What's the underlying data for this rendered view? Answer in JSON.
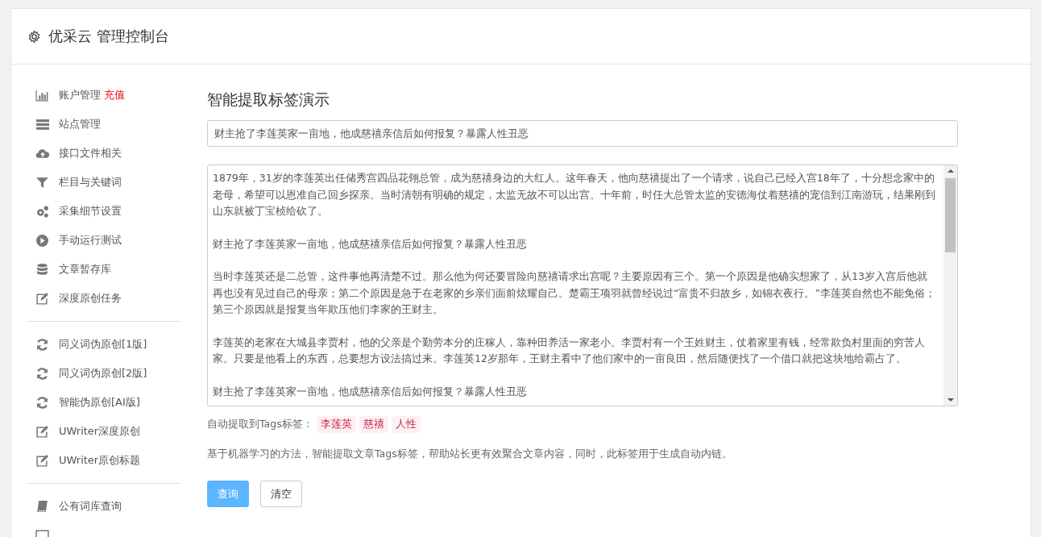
{
  "header": {
    "title": "优采云 管理控制台"
  },
  "sidebar": {
    "groups": [
      [
        {
          "kind": "chart",
          "label": "账户管理",
          "badge": "充值"
        },
        {
          "kind": "server",
          "label": "站点管理"
        },
        {
          "kind": "cloud",
          "label": "接口文件相关"
        },
        {
          "kind": "filter",
          "label": "栏目与关键词"
        },
        {
          "kind": "gears",
          "label": "采集细节设置"
        },
        {
          "kind": "play",
          "label": "手动运行测试"
        },
        {
          "kind": "database",
          "label": "文章暂存库"
        },
        {
          "kind": "edit",
          "label": "深度原创任务"
        }
      ],
      [
        {
          "kind": "refresh",
          "label": "同义词伪原创[1版]"
        },
        {
          "kind": "refresh",
          "label": "同义词伪原创[2版]"
        },
        {
          "kind": "refresh",
          "label": "智能伪原创[AI版]"
        },
        {
          "kind": "edit",
          "label": "UWriter深度原创"
        },
        {
          "kind": "edit",
          "label": "UWriter原创标题"
        }
      ],
      [
        {
          "kind": "book",
          "label": "公有词库查询"
        },
        {
          "kind": "window"
        }
      ]
    ]
  },
  "main": {
    "title": "智能提取标签演示",
    "title_field": {
      "value": "财主抢了李莲英家一亩地，他成慈禧亲信后如何报复？暴露人性丑恶"
    },
    "content_field": {
      "paragraphs": [
        "1879年，31岁的李莲英出任储秀宫四品花翎总管，成为慈禧身边的大红人。这年春天，他向慈禧提出了一个请求，说自己已经入宫18年了，十分想念家中的老母，希望可以恩准自己回乡探亲。当时清朝有明确的规定，太监无故不可以出宫。十年前，时任大总管太监的安德海仗着慈禧的宠信到江南游玩，结果刚到山东就被丁宝桢给砍了。",
        "财主抢了李莲英家一亩地，他成慈禧亲信后如何报复？暴露人性丑恶",
        "当时李莲英还是二总管，这件事他再清楚不过。那么他为何还要冒险向慈禧请求出宫呢？主要原因有三个。第一个原因是他确实想家了，从13岁入宫后他就再也没有见过自己的母亲；第二个原因是急于在老家的乡亲们面前炫耀自己。楚霸王项羽就曾经说过“富贵不归故乡，如锦衣夜行。”李莲英自然也不能免俗；第三个原因就是报复当年欺压他们李家的王财主。",
        "李莲英的老家在大城县李贾村，他的父亲是个勤劳本分的庄稼人，靠种田养活一家老小。李贾村有一个王姓财主，仗着家里有钱，经常欺负村里面的穷苦人家。只要是他看上的东西，总要想方设法搞过来。李莲英12岁那年，王财主看中了他们家中的一亩良田，然后随便找了一个借口就把这块地给霸占了。",
        "财主抢了李莲英家一亩地，他成慈禧亲信后如何报复？暴露人性丑恶"
      ]
    },
    "tags": {
      "label": "自动提取到Tags标签：",
      "items": [
        "李莲英",
        "慈禧",
        "人性"
      ]
    },
    "description": "基于机器学习的方法，智能提取文章Tags标签，帮助站长更有效聚合文章内容，同时，此标签用于生成自动内链。",
    "buttons": [
      {
        "label": "查询",
        "kind": "primary"
      },
      {
        "label": "清空",
        "kind": "default"
      }
    ]
  }
}
